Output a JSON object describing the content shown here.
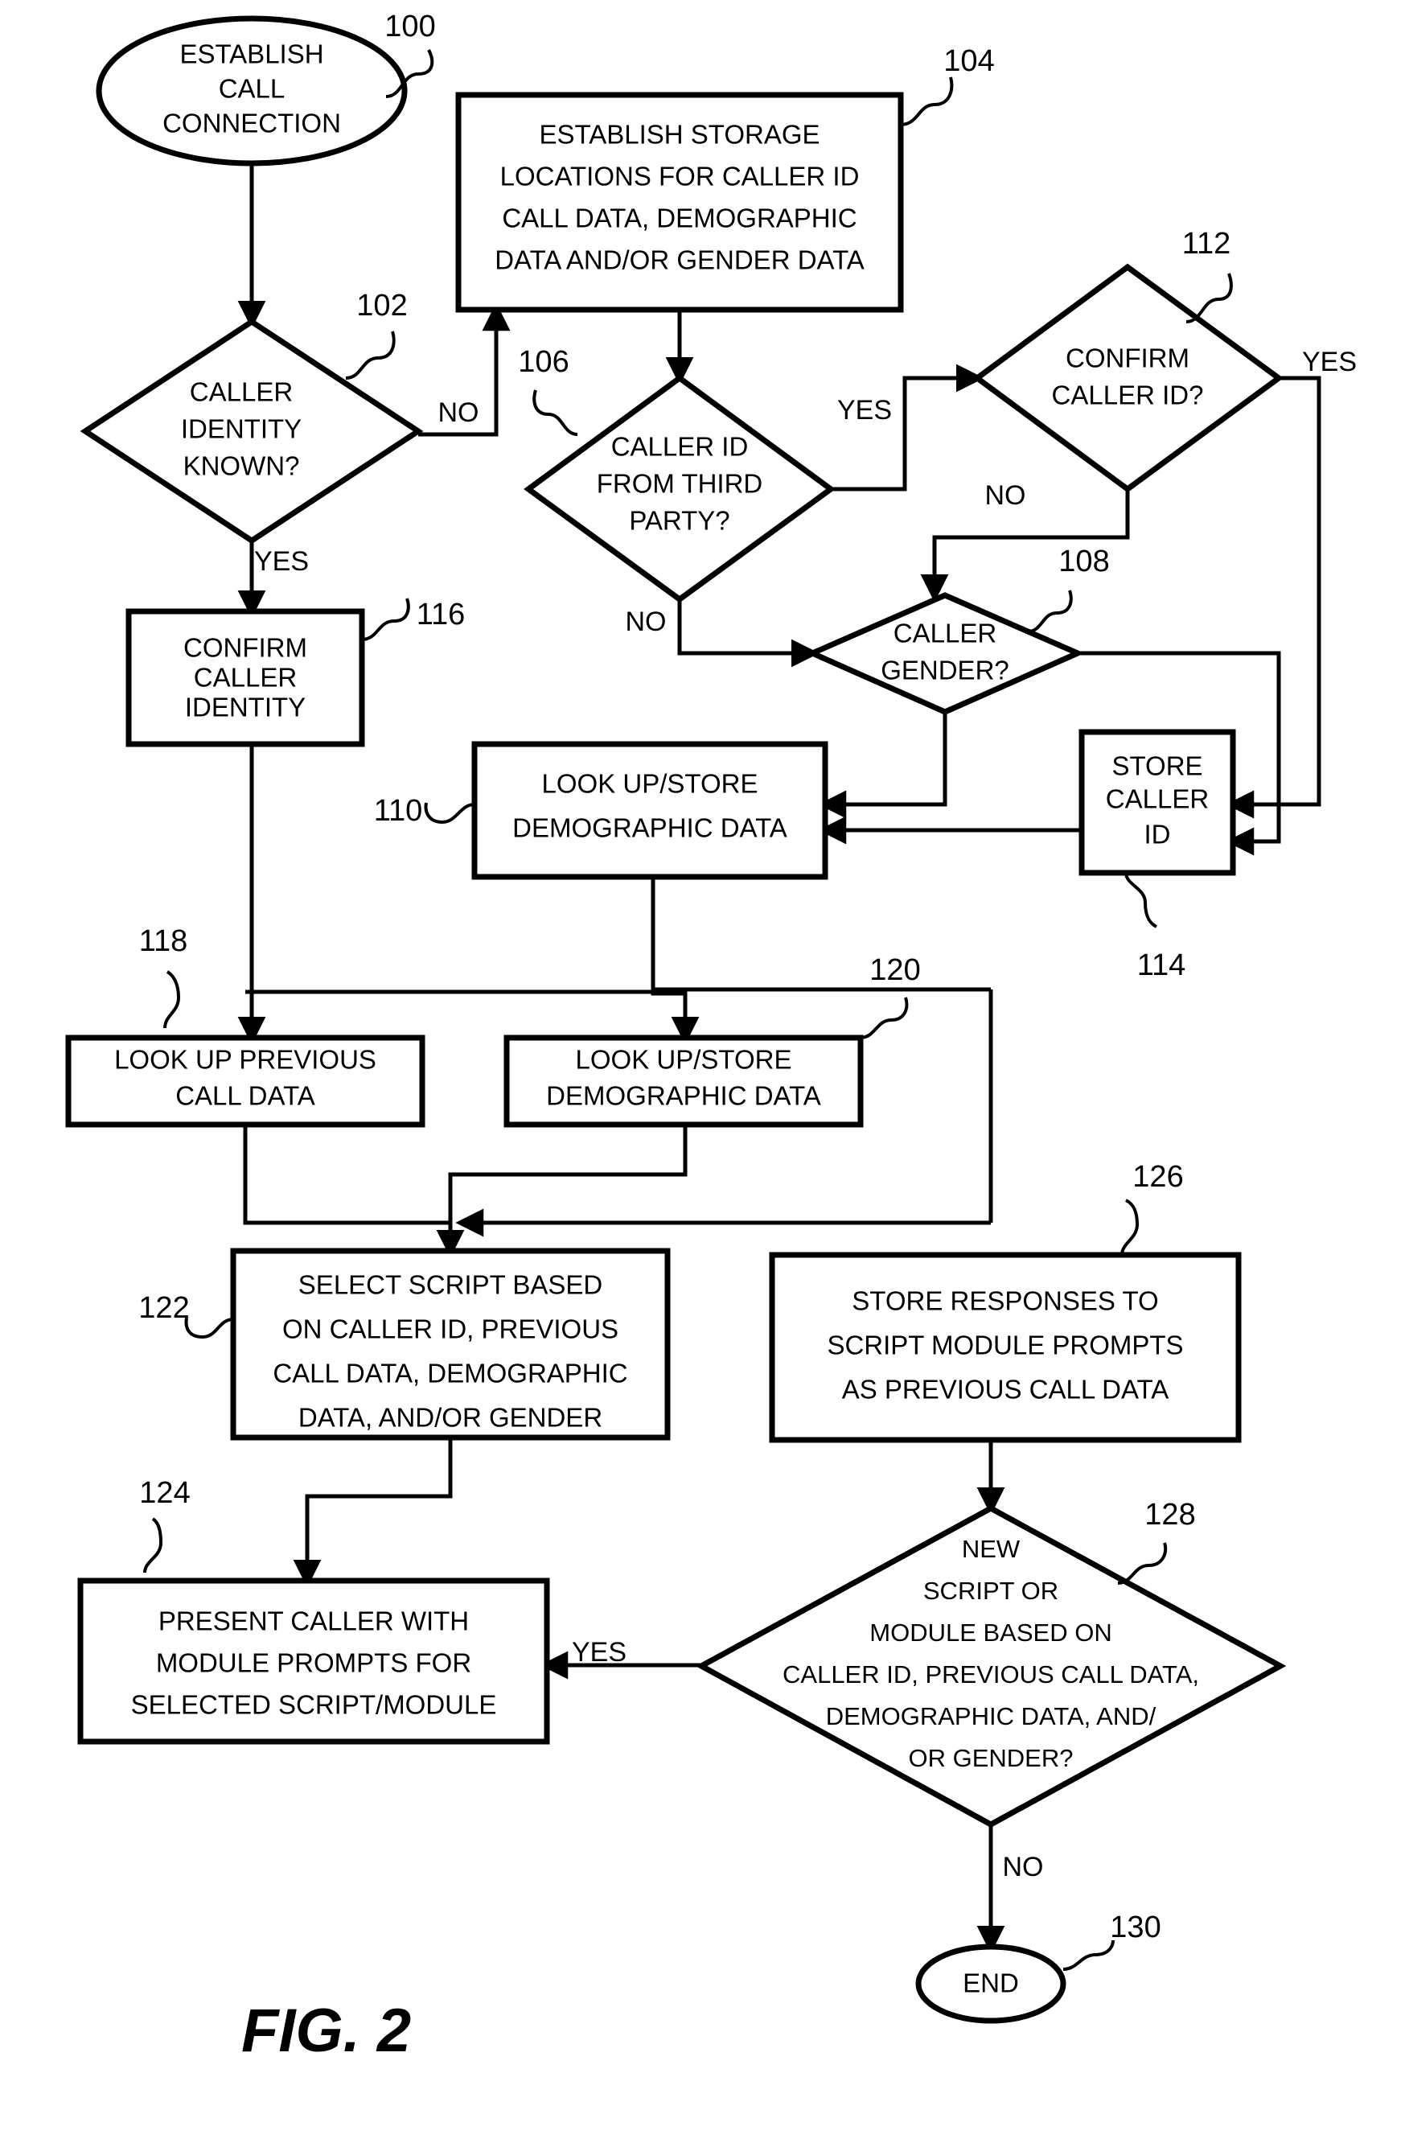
{
  "figure": {
    "label": "FIG. 2",
    "title": "Call handling flowchart with caller ID, demographic and gender data"
  },
  "colors": {
    "ink": "#000000",
    "paper": "#ffffff"
  },
  "nodes": [
    {
      "id": "n100",
      "ref": "100",
      "shape": "ellipse",
      "lines": [
        "ESTABLISH",
        "CALL",
        "CONNECTION"
      ]
    },
    {
      "id": "n104",
      "ref": "104",
      "shape": "process",
      "lines": [
        "ESTABLISH STORAGE",
        "LOCATIONS FOR CALLER ID",
        "CALL DATA, DEMOGRAPHIC",
        "DATA AND/OR GENDER DATA"
      ]
    },
    {
      "id": "n102",
      "ref": "102",
      "shape": "decision",
      "lines": [
        "CALLER",
        "IDENTITY",
        "KNOWN?"
      ]
    },
    {
      "id": "n106",
      "ref": "106",
      "shape": "decision",
      "lines": [
        "CALLER ID",
        "FROM THIRD",
        "PARTY?"
      ]
    },
    {
      "id": "n112",
      "ref": "112",
      "shape": "decision",
      "lines": [
        "CONFIRM",
        "CALLER ID?"
      ]
    },
    {
      "id": "n108",
      "ref": "108",
      "shape": "decision",
      "lines": [
        "CALLER",
        "GENDER?"
      ]
    },
    {
      "id": "n116",
      "ref": "116",
      "shape": "process",
      "lines": [
        "CONFIRM",
        "CALLER",
        "IDENTITY"
      ]
    },
    {
      "id": "n110",
      "ref": "110",
      "shape": "process",
      "lines": [
        "LOOK UP/STORE",
        "DEMOGRAPHIC DATA"
      ]
    },
    {
      "id": "n114",
      "ref": "114",
      "shape": "process",
      "lines": [
        "STORE",
        "CALLER",
        "ID"
      ]
    },
    {
      "id": "n118",
      "ref": "118",
      "shape": "process",
      "lines": [
        "LOOK UP PREVIOUS",
        "CALL DATA"
      ]
    },
    {
      "id": "n120",
      "ref": "120",
      "shape": "process",
      "lines": [
        "LOOK UP/STORE",
        "DEMOGRAPHIC DATA"
      ]
    },
    {
      "id": "n122",
      "ref": "122",
      "shape": "process",
      "lines": [
        "SELECT SCRIPT BASED",
        "ON CALLER ID, PREVIOUS",
        "CALL DATA, DEMOGRAPHIC",
        "DATA, AND/OR GENDER"
      ]
    },
    {
      "id": "n126",
      "ref": "126",
      "shape": "process",
      "lines": [
        "STORE RESPONSES TO",
        "SCRIPT MODULE PROMPTS",
        "AS PREVIOUS CALL DATA"
      ]
    },
    {
      "id": "n124",
      "ref": "124",
      "shape": "process",
      "lines": [
        "PRESENT CALLER WITH",
        "MODULE PROMPTS FOR",
        "SELECTED SCRIPT/MODULE"
      ]
    },
    {
      "id": "n128",
      "ref": "128",
      "shape": "decision",
      "lines": [
        "NEW",
        "SCRIPT OR",
        "MODULE BASED ON",
        "CALLER ID, PREVIOUS CALL DATA,",
        "DEMOGRAPHIC DATA, AND/",
        "OR GENDER?"
      ]
    },
    {
      "id": "n130",
      "ref": "130",
      "shape": "ellipse",
      "lines": [
        "END"
      ]
    }
  ],
  "edge_labels": [
    {
      "id": "e102no",
      "text": "NO"
    },
    {
      "id": "e102yes",
      "text": "YES"
    },
    {
      "id": "e106yes",
      "text": "YES"
    },
    {
      "id": "e106no",
      "text": "NO"
    },
    {
      "id": "e112yes",
      "text": "YES"
    },
    {
      "id": "e112no",
      "text": "NO"
    },
    {
      "id": "e128yes",
      "text": "YES"
    },
    {
      "id": "e128no",
      "text": "NO"
    }
  ],
  "node_text": {
    "n100": {
      "l0": "ESTABLISH",
      "l1": "CALL",
      "l2": "CONNECTION"
    },
    "n104": {
      "l0": "ESTABLISH STORAGE",
      "l1": "LOCATIONS FOR CALLER ID",
      "l2": "CALL DATA, DEMOGRAPHIC",
      "l3": "DATA AND/OR GENDER DATA"
    },
    "n102": {
      "l0": "CALLER",
      "l1": "IDENTITY",
      "l2": "KNOWN?"
    },
    "n106": {
      "l0": "CALLER ID",
      "l1": "FROM THIRD",
      "l2": "PARTY?"
    },
    "n112": {
      "l0": "CONFIRM",
      "l1": "CALLER ID?"
    },
    "n108": {
      "l0": "CALLER",
      "l1": "GENDER?"
    },
    "n116": {
      "l0": "CONFIRM",
      "l1": "CALLER",
      "l2": "IDENTITY"
    },
    "n110": {
      "l0": "LOOK UP/STORE",
      "l1": "DEMOGRAPHIC DATA"
    },
    "n114": {
      "l0": "STORE",
      "l1": "CALLER",
      "l2": "ID"
    },
    "n118": {
      "l0": "LOOK UP PREVIOUS",
      "l1": "CALL DATA"
    },
    "n120": {
      "l0": "LOOK UP/STORE",
      "l1": "DEMOGRAPHIC DATA"
    },
    "n122": {
      "l0": "SELECT SCRIPT BASED",
      "l1": "ON CALLER ID, PREVIOUS",
      "l2": "CALL DATA, DEMOGRAPHIC",
      "l3": "DATA, AND/OR GENDER"
    },
    "n126": {
      "l0": "STORE RESPONSES TO",
      "l1": "SCRIPT MODULE PROMPTS",
      "l2": "AS PREVIOUS CALL DATA"
    },
    "n124": {
      "l0": "PRESENT CALLER WITH",
      "l1": "MODULE PROMPTS FOR",
      "l2": "SELECTED SCRIPT/MODULE"
    },
    "n128": {
      "l0": "NEW",
      "l1": "SCRIPT OR",
      "l2": "MODULE BASED ON",
      "l3": "CALLER ID, PREVIOUS CALL DATA,",
      "l4": "DEMOGRAPHIC DATA, AND/",
      "l5": "OR GENDER?"
    },
    "n130": {
      "l0": "END"
    }
  },
  "refs": {
    "r100": "100",
    "r102": "102",
    "r104": "104",
    "r106": "106",
    "r108": "108",
    "r110": "110",
    "r112": "112",
    "r114": "114",
    "r116": "116",
    "r118": "118",
    "r120": "120",
    "r122": "122",
    "r124": "124",
    "r126": "126",
    "r128": "128",
    "r130": "130"
  },
  "labels": {
    "no_102": "NO",
    "yes_102": "YES",
    "yes_106": "YES",
    "no_106": "NO",
    "yes_112": "YES",
    "no_112": "NO",
    "yes_128": "YES",
    "no_128": "NO"
  }
}
